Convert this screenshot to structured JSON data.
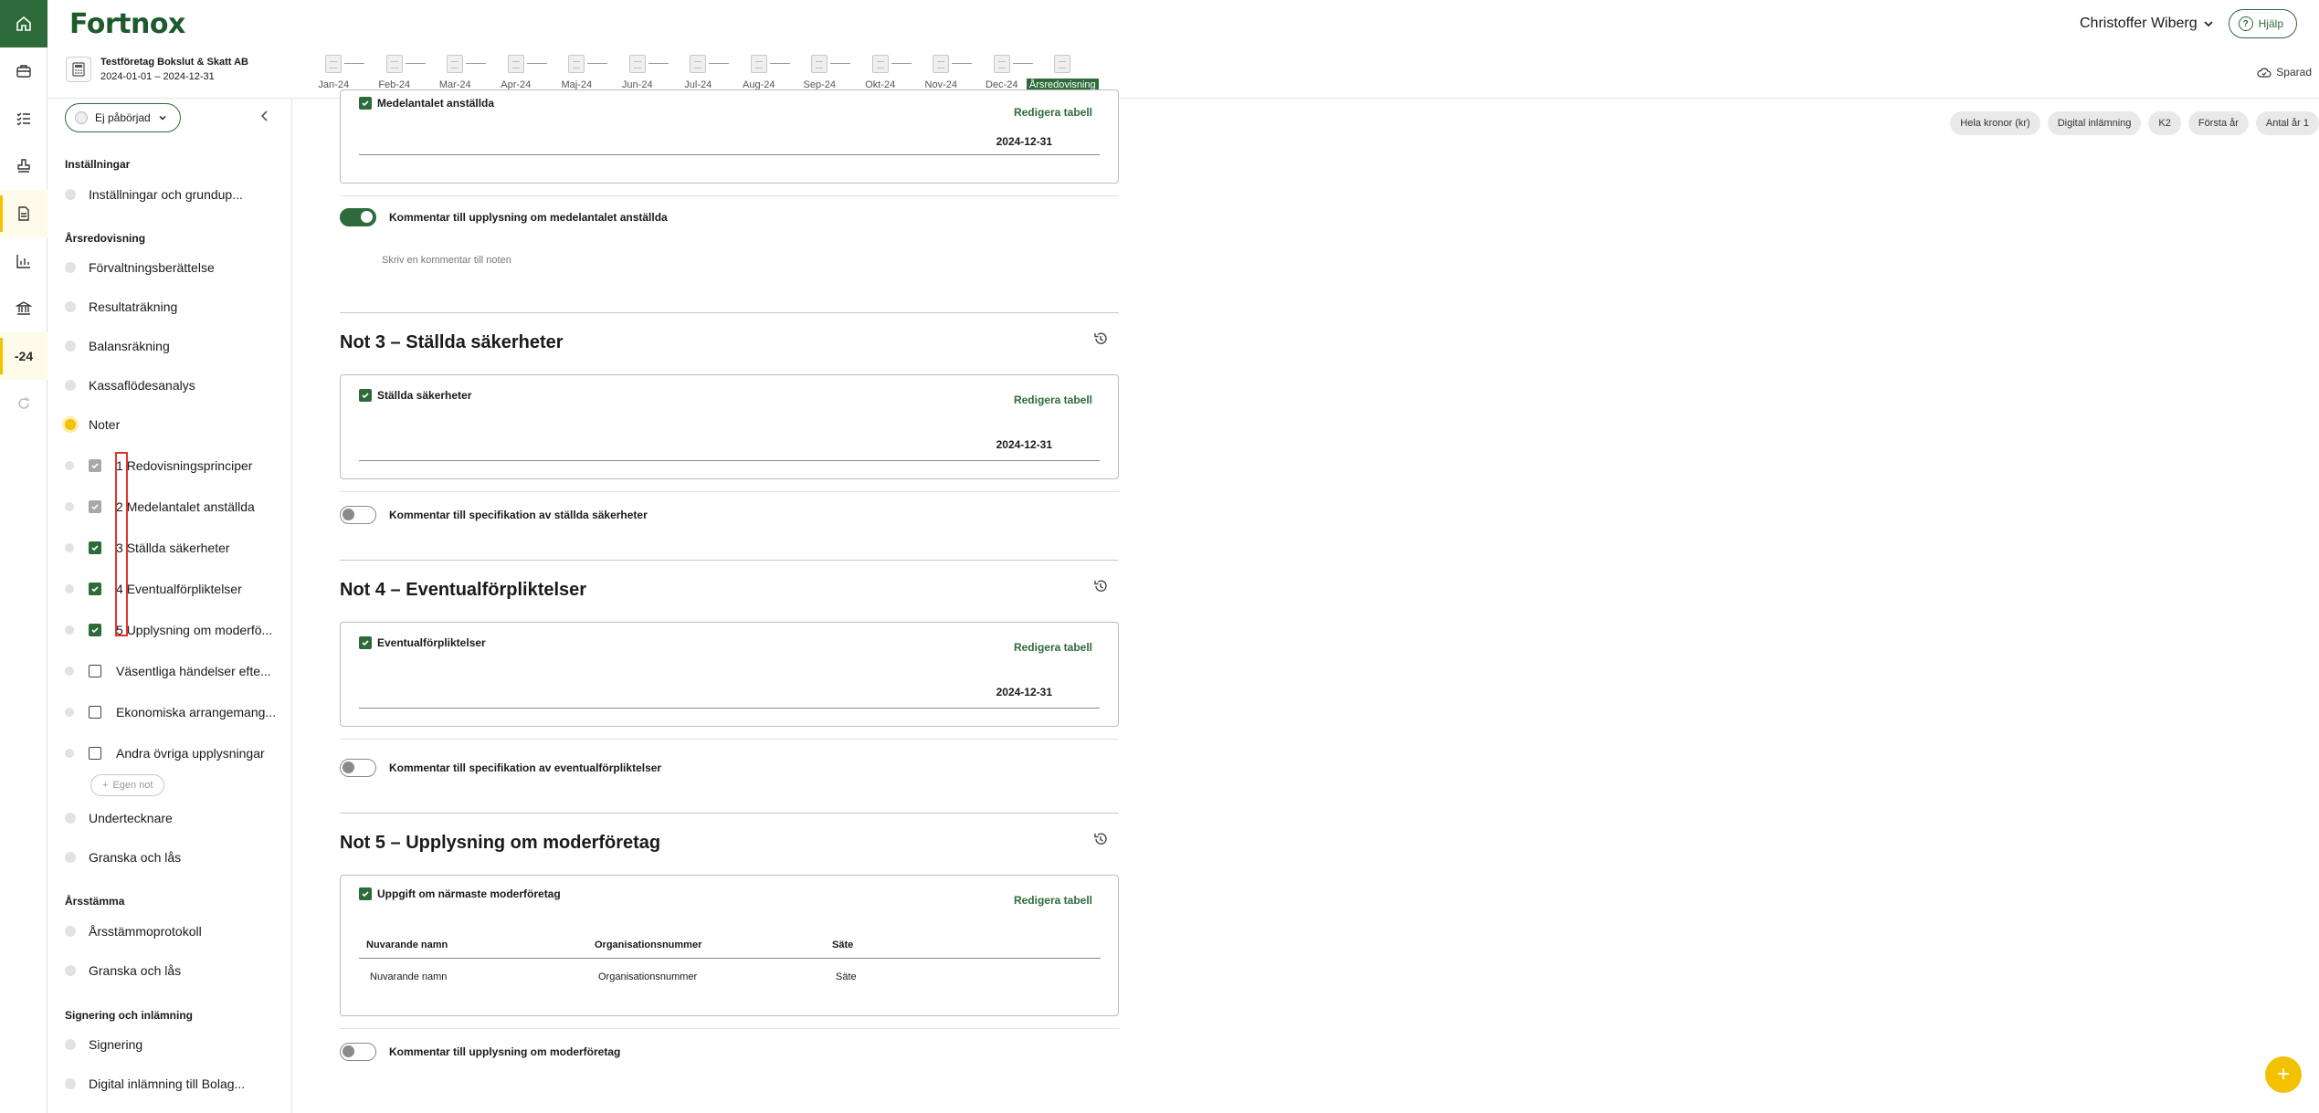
{
  "header": {
    "logo": "Fortnox",
    "user": "Christoffer Wiberg",
    "help": "Hjälp"
  },
  "company": {
    "name": "Testföretag Bokslut & Skatt AB",
    "period": "2024-01-01 – 2024-12-31",
    "saved": "Sparad"
  },
  "rail": {
    "year_badge": "-24"
  },
  "months": [
    "Jan-24",
    "Feb-24",
    "Mar-24",
    "Apr-24",
    "Maj-24",
    "Jun-24",
    "Jul-24",
    "Aug-24",
    "Sep-24",
    "Okt-24",
    "Nov-24",
    "Dec-24",
    "Årsredovisning"
  ],
  "sidebar": {
    "status": "Ej påbörjad",
    "sections": {
      "installningar": "Inställningar",
      "arsredovisning": "Årsredovisning",
      "arsstamma": "Årsstämma",
      "signering": "Signering och inlämning"
    },
    "items": {
      "installningar": "Inställningar och grundup...",
      "forvaltning": "Förvaltningsberättelse",
      "resultat": "Resultaträkning",
      "balans": "Balansräkning",
      "kassaflode": "Kassaflödesanalys",
      "noter": "Noter",
      "undertecknare": "Undertecknare",
      "granska1": "Granska och lås",
      "protokoll": "Årsstämmoprotokoll",
      "granska2": "Granska och lås",
      "signering": "Signering",
      "digital": "Digital inlämning till Bolag..."
    },
    "notes": [
      {
        "num": "1",
        "label": "Redovisningsprinciper",
        "state": "grey"
      },
      {
        "num": "2",
        "label": "Medelantalet anställda",
        "state": "grey"
      },
      {
        "num": "3",
        "label": "Ställda säkerheter",
        "state": "on"
      },
      {
        "num": "4",
        "label": "Eventualförpliktelser",
        "state": "on"
      },
      {
        "num": "5",
        "label": "Upplysning om moderfö...",
        "state": "on"
      },
      {
        "num": "",
        "label": "Väsentliga händelser efte...",
        "state": "off"
      },
      {
        "num": "",
        "label": "Ekonomiska arrangemang...",
        "state": "off"
      },
      {
        "num": "",
        "label": "Andra övriga upplysningar",
        "state": "off"
      }
    ],
    "add_note": "Egen not"
  },
  "chips": [
    "Hela kronor (kr)",
    "Digital inlämning",
    "K2",
    "Första år",
    "Antal år 1"
  ],
  "main": {
    "edit_label": "Redigera tabell",
    "note2": {
      "box_label": "Medelantalet anställda",
      "date": "2024-12-31",
      "comment_toggle": "Kommentar till upplysning om medelantalet anställda",
      "comment_placeholder": "Skriv en kommentar till noten"
    },
    "note3": {
      "title": "Not 3 – Ställda säkerheter",
      "box_label": "Ställda säkerheter",
      "date": "2024-12-31",
      "comment_toggle": "Kommentar till specifikation av ställda säkerheter"
    },
    "note4": {
      "title": "Not 4 – Eventualförpliktelser",
      "box_label": "Eventualförpliktelser",
      "date": "2024-12-31",
      "comment_toggle": "Kommentar till specifikation av eventualförpliktelser"
    },
    "note5": {
      "title": "Not 5 – Upplysning om moderföretag",
      "box_label": "Uppgift om närmaste moderföretag",
      "columns": [
        "Nuvarande namn",
        "Organisationsnummer",
        "Säte"
      ],
      "row": [
        "Nuvarande namn",
        "Organisationsnummer",
        "Säte"
      ],
      "comment_toggle": "Kommentar till upplysning om moderföretag"
    }
  },
  "colors": {
    "brand": "#2e6b3a",
    "accent": "#f2c200"
  }
}
